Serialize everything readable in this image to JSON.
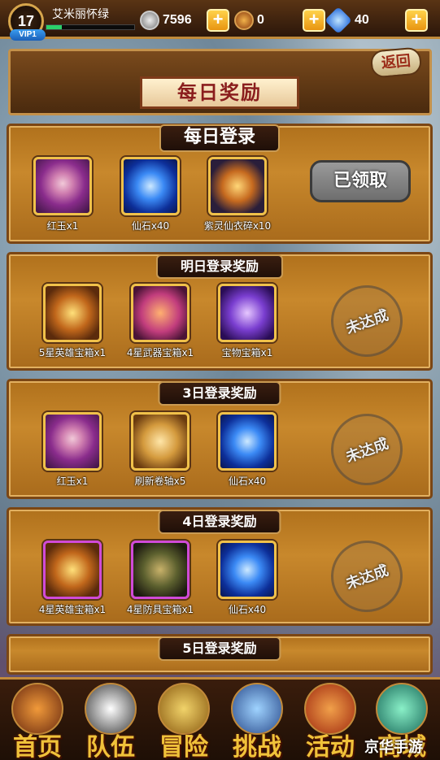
{
  "player": {
    "level": "17",
    "name": "艾米丽怀绿",
    "vip": "VIP1",
    "exp_fraction": 0.18
  },
  "resources": {
    "silver": "7596",
    "medal": "0",
    "gem": "40"
  },
  "header": {
    "title": "每日奖励",
    "back_label": "返回"
  },
  "daily_login": {
    "title": "每日登录",
    "button_label": "已领取",
    "items": [
      {
        "icon": "red-jade-portrait",
        "label": "红玉x1"
      },
      {
        "icon": "immortal-stone-crystal",
        "label": "仙石x40"
      },
      {
        "icon": "armor-fragment",
        "label": "紫灵仙衣碎x10"
      }
    ]
  },
  "rewards": [
    {
      "title": "明日登录奖励",
      "status": "未达成",
      "items": [
        {
          "icon": "hero-chest",
          "label": "5星英雄宝箱x1"
        },
        {
          "icon": "weapon-chest",
          "label": "4星武器宝箱x1"
        },
        {
          "icon": "treasure-chest",
          "label": "宝物宝箱x1"
        }
      ]
    },
    {
      "title": "3日登录奖励",
      "status": "未达成",
      "items": [
        {
          "icon": "red-jade-portrait",
          "label": "红玉x1"
        },
        {
          "icon": "refresh-scroll",
          "label": "刷新卷轴x5"
        },
        {
          "icon": "immortal-stone-crystal",
          "label": "仙石x40"
        }
      ]
    },
    {
      "title": "4日登录奖励",
      "status": "未达成",
      "items": [
        {
          "icon": "hero-chest",
          "label": "4星英雄宝箱x1"
        },
        {
          "icon": "armor-chest",
          "label": "4星防具宝箱x1"
        },
        {
          "icon": "immortal-stone-crystal",
          "label": "仙石x40"
        }
      ]
    },
    {
      "title": "5日登录奖励"
    }
  ],
  "nav": [
    {
      "label": "首页",
      "icon": "home-icon"
    },
    {
      "label": "队伍",
      "icon": "team-icon"
    },
    {
      "label": "冒险",
      "icon": "adventure-icon"
    },
    {
      "label": "挑战",
      "icon": "challenge-icon"
    },
    {
      "label": "活动",
      "icon": "event-icon"
    },
    {
      "label": "商城",
      "icon": "shop-icon"
    }
  ],
  "watermark": "京华手游",
  "colors": {
    "frame_gold": "#c4914a",
    "panel_wood": "#c8882c",
    "nav_text": "#f0c23a"
  }
}
